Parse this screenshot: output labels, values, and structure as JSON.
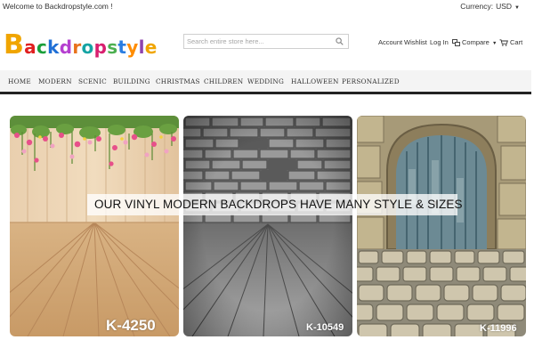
{
  "topbar": {
    "welcome": "Welcome to Backdropstyle.com !",
    "currency_label": "Currency:",
    "currency_value": "USD"
  },
  "logo": {
    "initial": "B",
    "rest": "ackdropstyle",
    "colors": [
      "#f0a500",
      "#e02020",
      "#1a9f3a",
      "#1f6fd6",
      "#b53fd0",
      "#e8721c",
      "#16a4a4",
      "#d81f6f",
      "#4caf50",
      "#2a7de1",
      "#ff8c00",
      "#8e44ad"
    ]
  },
  "search": {
    "placeholder": "Search entire store here..."
  },
  "account_links": {
    "account": "Account",
    "wishlist": "Wishlist",
    "login": "Log In",
    "compare": "Compare",
    "cart": "Cart"
  },
  "nav": [
    "HOME",
    "MODERN",
    "SCENIC",
    "BUILDING",
    "CHRISTMAS",
    "CHILDREN",
    "WEDDING",
    "HALLOWEEN",
    "PERSONALIZED"
  ],
  "banner": {
    "headline": "OUR VINYL MODERN BACKDROPS HAVE MANY STYLE & SIZES",
    "codes": [
      "K-4250",
      "K-10549",
      "K-11996"
    ]
  }
}
